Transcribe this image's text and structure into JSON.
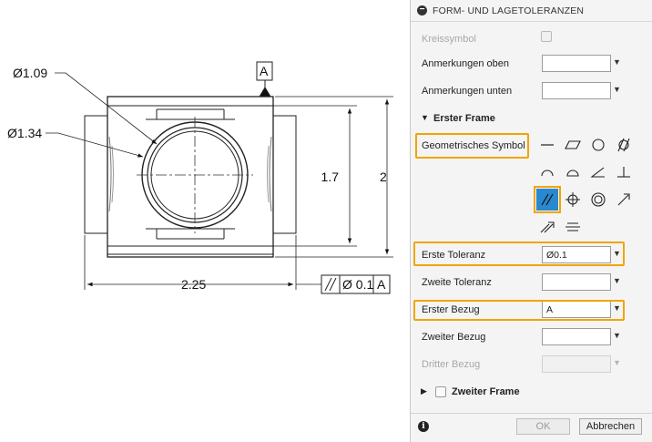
{
  "drawing": {
    "dim_dia_inner": "Ø1.09",
    "dim_dia_outer": "Ø1.34",
    "datum_label": "A",
    "dim_height_inner": "1.7",
    "dim_height_outer": "2",
    "dim_width": "2.25",
    "fcf_tolerance": "Ø 0.1",
    "fcf_datum": "A"
  },
  "panel": {
    "title": "FORM- UND LAGETOLERANZEN",
    "kreissymbol_label": "Kreissymbol",
    "anmerkungen_oben_label": "Anmerkungen oben",
    "anmerkungen_oben_value": "",
    "anmerkungen_unten_label": "Anmerkungen unten",
    "anmerkungen_unten_value": "",
    "erster_frame_title": "Erster Frame",
    "geometrisches_symbol_label": "Geometrisches Symbol",
    "symbols": [
      "straightness",
      "flatness",
      "circularity",
      "cylindricity",
      "profile-line",
      "profile-surface",
      "angularity",
      "perpendicularity",
      "parallelism",
      "position",
      "concentricity",
      "circular-runout",
      "total-runout",
      "symmetry"
    ],
    "selected_symbol": "parallelism",
    "erste_toleranz_label": "Erste Toleranz",
    "erste_toleranz_value": "Ø0.1",
    "zweite_toleranz_label": "Zweite Toleranz",
    "zweite_toleranz_value": "",
    "erster_bezug_label": "Erster Bezug",
    "erster_bezug_value": "A",
    "zweiter_bezug_label": "Zweiter Bezug",
    "zweiter_bezug_value": "",
    "dritter_bezug_label": "Dritter Bezug",
    "dritter_bezug_value": "",
    "zweiter_frame_title": "Zweiter Frame",
    "ok_label": "OK",
    "cancel_label": "Abbrechen",
    "info_icon": "i"
  },
  "colors": {
    "highlight": "#f0a500",
    "selected_symbol_bg": "#2a88d0"
  }
}
